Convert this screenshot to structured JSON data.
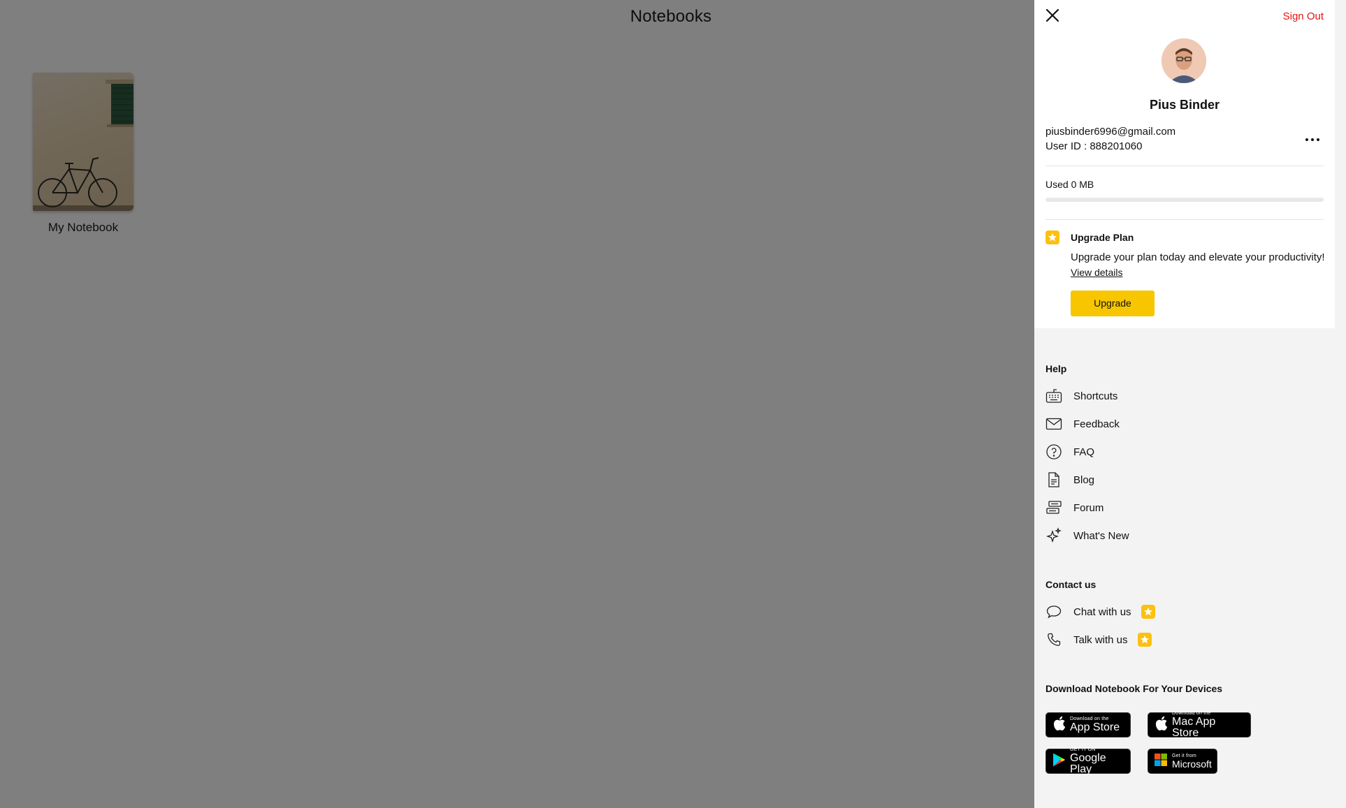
{
  "main": {
    "title": "Notebooks",
    "notebooks": [
      {
        "title": "My Notebook"
      }
    ]
  },
  "panel": {
    "sign_out": "Sign Out",
    "user": {
      "name": "Pius Binder",
      "email": "piusbinder6996@gmail.com",
      "user_id": "User ID : 888201060"
    },
    "storage": {
      "label": "Used 0 MB",
      "used_fraction": 0
    },
    "upgrade": {
      "title": "Upgrade Plan",
      "description": "Upgrade your plan today and elevate your productivity!",
      "link": "View details",
      "button": "Upgrade"
    },
    "help": {
      "title": "Help",
      "items": [
        {
          "label": "Shortcuts",
          "icon": "keyboard-icon"
        },
        {
          "label": "Feedback",
          "icon": "mail-icon"
        },
        {
          "label": "FAQ",
          "icon": "question-icon"
        },
        {
          "label": "Blog",
          "icon": "document-icon"
        },
        {
          "label": "Forum",
          "icon": "forum-icon"
        },
        {
          "label": "What's New",
          "icon": "sparkle-icon"
        }
      ]
    },
    "contact": {
      "title": "Contact us",
      "items": [
        {
          "label": "Chat with us",
          "icon": "chat-bubble-icon",
          "premium": true
        },
        {
          "label": "Talk with us",
          "icon": "phone-icon",
          "premium": true
        }
      ]
    },
    "download": {
      "title": "Download Notebook For Your Devices",
      "stores": [
        {
          "small": "Download on the",
          "big": "App Store",
          "icon": "apple-icon"
        },
        {
          "small": "Download on the",
          "big": "Mac App Store",
          "icon": "apple-icon"
        },
        {
          "small": "GET IT ON",
          "big": "Google Play",
          "icon": "google-play-icon"
        },
        {
          "small": "Get it from",
          "big": "Microsoft",
          "icon": "microsoft-icon"
        }
      ]
    },
    "colors": {
      "accent": "#f7c600",
      "sign_out": "#e01414",
      "overlay": "#808080"
    }
  }
}
